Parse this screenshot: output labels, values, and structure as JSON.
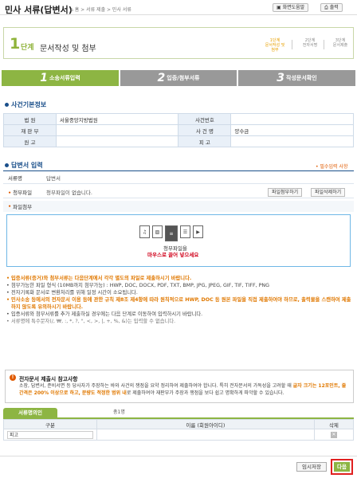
{
  "header": {
    "title": "민사 서류(답변서)",
    "breadcrumb": "홈 > 서류 제출 > 민사 서류",
    "screen_help": "화면도움말",
    "print": "출력"
  },
  "step": {
    "number": "1",
    "label": "단계",
    "subtitle": "문서작성 및 첨부",
    "mini_steps": [
      {
        "num": "1단계",
        "text": "문서작성 및 첨부",
        "active": true
      },
      {
        "num": "2단계",
        "text": "전자서명",
        "active": false
      },
      {
        "num": "3단계",
        "text": "문서제출",
        "active": false
      }
    ]
  },
  "tabs": [
    {
      "n": "1",
      "label": "소송서류입력"
    },
    {
      "n": "2",
      "label": "입증/첨부서류"
    },
    {
      "n": "3",
      "label": "작성문서확인"
    }
  ],
  "case_info": {
    "title": "사건기본정보",
    "court_label": "법 원",
    "court_value": "서울중앙지방법원",
    "case_no_label": "사건번호",
    "case_no_value": "",
    "judge_label": "재 판 부",
    "judge_value": "",
    "case_name_label": "사 건 명",
    "case_name_value": "양수금",
    "plaintiff_label": "원 고",
    "plaintiff_value": "",
    "defendant_label": "피 고",
    "defendant_value": ""
  },
  "answer": {
    "title": "답변서 입력",
    "required_note": "• 필수입력 사항",
    "doc_name_label": "서류명",
    "doc_name_value": "답변서",
    "attach_label": "청부파일",
    "attach_value": "청부파일이 없습니다.",
    "attach_btn": "파일첨부하기",
    "delete_btn": "파일삭제하기",
    "file_attach_label": "파일첨부",
    "drop_text1": "청부파일을",
    "drop_text2": "마우스로 끌어 넣으세요"
  },
  "notes": [
    {
      "text": "입증서류(증거)와 첨부서류는 다음단계에서 각각 별도의 파일로 제출하시기 바랍니다.",
      "style": "hl"
    },
    {
      "text": "첨부가능한 파일 형식 (10MB까지 첨부가능) : HWP, DOC, DOCX, PDF, TXT, BMP, JPG, JPEG, GIF, TIF, TIFF, PNG",
      "style": ""
    },
    {
      "text": "전자기록화 문서로 변환처리를 위해 일정 시간이 소요됩니다.",
      "style": ""
    },
    {
      "text": "민사소송 등에서의 전자문서 이용 등에 관한 규칙 제8조 제4항에 따라 원칙적으로 HWP, DOC 등 원본 파일을 직접 제출하여야 하므로, 출력물을 스캔하여 제출하지 않도록 유의하시기 바랍니다.",
      "style": "hl"
    },
    {
      "text": "입증서류와 첨부서류를 추가 제출하실 경우에는 다음 단계로 이동하여 입력하시기 바랍니다.",
      "style": ""
    },
    {
      "text": "서류명에 특수문자(/, ₩, :, *, ?, \", <, >, |, +, %, &)는 입력할 수 없습니다.",
      "style": "gray"
    }
  ],
  "caution": {
    "icon": "!",
    "title": "전자문서 제출시 참고사항",
    "body_pre": "소장, 답변서, 준비서면 등 당사자가 주장하는 바와 사건의 쟁점을 요약 정리하여 제출하여야 합니다. 특히 전자문서의 가독성을 고려할 때 ",
    "body_em": "글자 크기는 12포인트, 줄 간격은 200% 이상으로 하고, 분량도 적정한 범위 내",
    "body_post": "로 제출하여야 재판부가 주장과 쟁점을 보다 쉽고 명확하게 파악할 수 있습니다."
  },
  "confirm": {
    "tab": "서류명의인",
    "count": "총1명",
    "col_kind": "구분",
    "col_name": "이름 (회원아이디)",
    "col_delete": "삭제",
    "rows": [
      {
        "kind": "피고",
        "name": ""
      }
    ]
  },
  "footer": {
    "save": "임시저장",
    "next": "다음"
  },
  "colors": {
    "accent_green": "#8db543",
    "section_blue": "#1a4f8a",
    "warn_orange": "#e07800",
    "highlight_red": "#e02020"
  }
}
